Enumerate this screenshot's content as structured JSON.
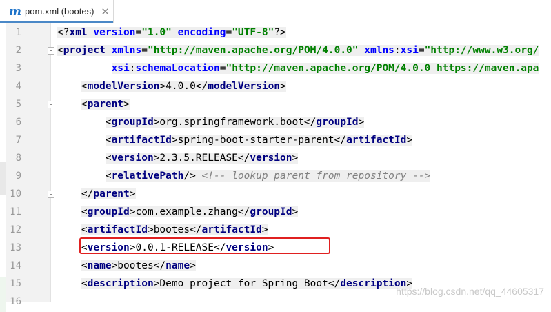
{
  "tab": {
    "icon": "maven-m-icon",
    "icon_glyph": "m",
    "title": "pom.xml (bootes)",
    "close": "✕"
  },
  "colors": {
    "tag": "#000080",
    "attr": "#0000ff",
    "value": "#008000",
    "comment": "#808080",
    "highlight_box": "#e02020"
  },
  "lines": [
    {
      "n": "1",
      "tokens": [
        [
          "txt",
          "<?"
        ],
        [
          "tag",
          "xml "
        ],
        [
          "attr",
          "version"
        ],
        [
          "txt",
          "="
        ],
        [
          "val",
          "\"1.0\""
        ],
        [
          "txt",
          " "
        ],
        [
          "attr",
          "encoding"
        ],
        [
          "txt",
          "="
        ],
        [
          "val",
          "\"UTF-8\""
        ],
        [
          "txt",
          "?>"
        ]
      ]
    },
    {
      "n": "2",
      "tokens": [
        [
          "txt",
          "<"
        ],
        [
          "tag",
          "project "
        ],
        [
          "attr",
          "xmlns"
        ],
        [
          "txt",
          "="
        ],
        [
          "val",
          "\"http://maven.apache.org/POM/4.0.0\""
        ],
        [
          "txt",
          " "
        ],
        [
          "attr",
          "xmlns"
        ],
        [
          "txt",
          ":"
        ],
        [
          "attr",
          "xsi"
        ],
        [
          "txt",
          "="
        ],
        [
          "val",
          "\"http://www.w3.org/"
        ]
      ]
    },
    {
      "n": "3",
      "tokens": [
        [
          "txt",
          "         "
        ],
        [
          "attr",
          "xsi"
        ],
        [
          "txt",
          ":"
        ],
        [
          "attr",
          "schemaLocation"
        ],
        [
          "txt",
          "="
        ],
        [
          "val",
          "\"http://maven.apache.org/POM/4.0.0 https://maven.apa"
        ]
      ]
    },
    {
      "n": "4",
      "tokens": [
        [
          "txt",
          "    <"
        ],
        [
          "tag",
          "modelVersion"
        ],
        [
          "txt",
          ">4.0.0</"
        ],
        [
          "tag",
          "modelVersion"
        ],
        [
          "txt",
          ">"
        ]
      ]
    },
    {
      "n": "5",
      "tokens": [
        [
          "txt",
          "    <"
        ],
        [
          "tag",
          "parent"
        ],
        [
          "txt",
          ">"
        ]
      ]
    },
    {
      "n": "6",
      "tokens": [
        [
          "txt",
          "        <"
        ],
        [
          "tag",
          "groupId"
        ],
        [
          "txt",
          ">org.springframework.boot</"
        ],
        [
          "tag",
          "groupId"
        ],
        [
          "txt",
          ">"
        ]
      ]
    },
    {
      "n": "7",
      "tokens": [
        [
          "txt",
          "        <"
        ],
        [
          "tag",
          "artifactId"
        ],
        [
          "txt",
          ">spring-boot-starter-parent</"
        ],
        [
          "tag",
          "artifactId"
        ],
        [
          "txt",
          ">"
        ]
      ]
    },
    {
      "n": "8",
      "tokens": [
        [
          "txt",
          "        <"
        ],
        [
          "tag",
          "version"
        ],
        [
          "txt",
          ">2.3.5.RELEASE</"
        ],
        [
          "tag",
          "version"
        ],
        [
          "txt",
          ">"
        ]
      ]
    },
    {
      "n": "9",
      "tokens": [
        [
          "txt",
          "        <"
        ],
        [
          "tag",
          "relativePath"
        ],
        [
          "txt",
          "/> "
        ],
        [
          "cmt",
          "<!-- lookup parent from repository -->"
        ]
      ]
    },
    {
      "n": "10",
      "tokens": [
        [
          "txt",
          "    </"
        ],
        [
          "tag",
          "parent"
        ],
        [
          "txt",
          ">"
        ]
      ]
    },
    {
      "n": "11",
      "tokens": [
        [
          "txt",
          "    <"
        ],
        [
          "tag",
          "groupId"
        ],
        [
          "txt",
          ">com.example.zhang</"
        ],
        [
          "tag",
          "groupId"
        ],
        [
          "txt",
          ">"
        ]
      ]
    },
    {
      "n": "12",
      "tokens": [
        [
          "txt",
          "    <"
        ],
        [
          "tag",
          "artifactId"
        ],
        [
          "txt",
          ">bootes</"
        ],
        [
          "tag",
          "artifactId"
        ],
        [
          "txt",
          ">"
        ]
      ]
    },
    {
      "n": "13",
      "tokens": [
        [
          "txt",
          "    <"
        ],
        [
          "tag",
          "version"
        ],
        [
          "txt",
          ">0.0.1-RELEASE</"
        ],
        [
          "tag",
          "version"
        ],
        [
          "txt",
          ">"
        ]
      ]
    },
    {
      "n": "14",
      "tokens": [
        [
          "txt",
          "    <"
        ],
        [
          "tag",
          "name"
        ],
        [
          "txt",
          ">bootes</"
        ],
        [
          "tag",
          "name"
        ],
        [
          "txt",
          ">"
        ]
      ]
    },
    {
      "n": "15",
      "tokens": [
        [
          "txt",
          "    <"
        ],
        [
          "tag",
          "description"
        ],
        [
          "txt",
          ">Demo project for Spring Boot</"
        ],
        [
          "tag",
          "description"
        ],
        [
          "txt",
          ">"
        ]
      ]
    },
    {
      "n": "16",
      "tokens": []
    }
  ],
  "highlighted_lines": [
    "1",
    "2",
    "3",
    "4",
    "5",
    "6",
    "7",
    "8",
    "9",
    "10",
    "11",
    "12",
    "14",
    "15"
  ],
  "fold_markers": [
    "2",
    "5",
    "10"
  ],
  "watermark": "https://blog.csdn.net/qq_44605317"
}
